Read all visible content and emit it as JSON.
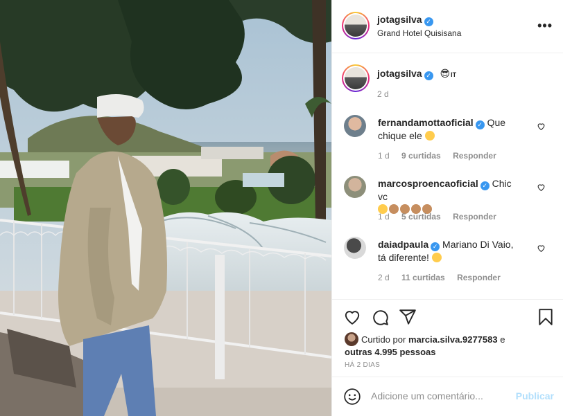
{
  "post": {
    "username": "jotagsilva",
    "location": "Grand Hotel Quisisana",
    "more_label": "•••"
  },
  "caption": {
    "username": "jotagsilva",
    "text": "IT",
    "time": "2 d"
  },
  "comments": [
    {
      "username": "fernandamottaoficial",
      "text": "Que chique ele",
      "emojis": [
        "heart-eyes-emoji"
      ],
      "time": "1 d",
      "likes": "9 curtidas",
      "reply": "Responder"
    },
    {
      "username": "marcosproencaoficial",
      "text": "Chic vc",
      "emojis": [
        "thumbs-up-emoji",
        "clap-emoji",
        "clap-emoji",
        "clap-emoji",
        "clap-emoji"
      ],
      "time": "1 d",
      "likes": "5 curtidas",
      "reply": "Responder"
    },
    {
      "username": "daiadpaula",
      "text": "Mariano Di Vaio, tá diferente!",
      "emojis": [
        "clap-emoji"
      ],
      "time": "2 d",
      "likes": "11 curtidas",
      "reply": "Responder"
    }
  ],
  "likes": {
    "prefix": "Curtido por",
    "liker": "marcia.silva.9277583",
    "middle": "e",
    "others": "outras 4.995 pessoas"
  },
  "post_age": "HÁ 2 DIAS",
  "add_comment": {
    "placeholder": "Adicione um comentário...",
    "publish_label": "Publicar"
  },
  "icons": {
    "verified": "verified-badge-icon",
    "like": "heart-icon",
    "comment": "comment-icon",
    "share": "paper-plane-icon",
    "save": "bookmark-icon",
    "emoji": "smiley-icon"
  },
  "colors": {
    "verified": "#3897f0",
    "publish": "#b2dffc",
    "muted": "#8e8e8e"
  }
}
